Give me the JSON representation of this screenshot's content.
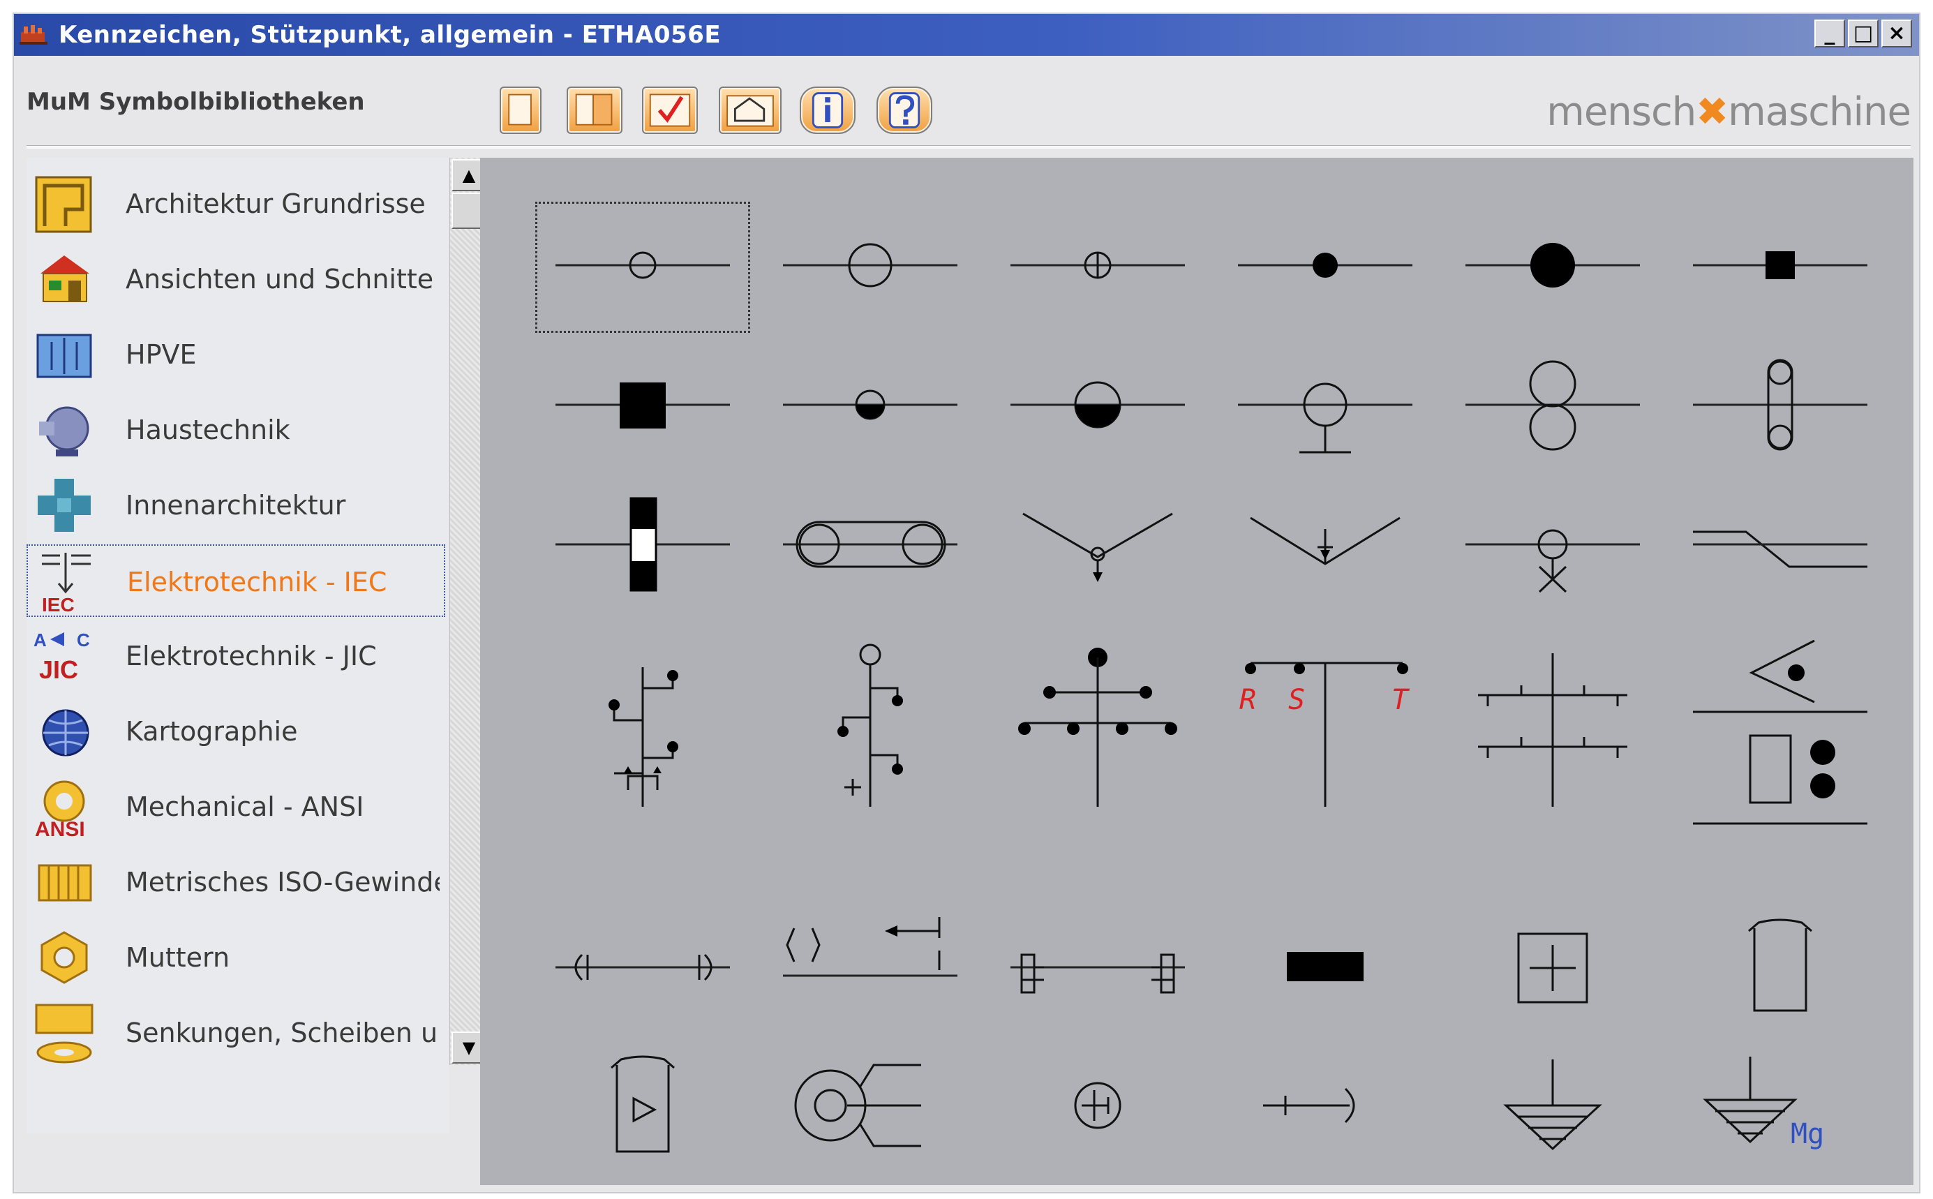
{
  "window": {
    "title": "Kennzeichen, Stützpunkt, allgemein  -  ETHA056E",
    "controls": [
      "_",
      "□",
      "×"
    ]
  },
  "toolbar": {
    "label": "MuM Symbolbibliotheken",
    "buttons": [
      "new-sheet-icon",
      "page-icon",
      "checkmark-icon",
      "house-icon",
      "info-icon",
      "help-icon"
    ],
    "brand": {
      "left": "mensch",
      "mark": "✖",
      "right": "maschine"
    }
  },
  "sidebar": {
    "items": [
      {
        "label": "Architektur Grundrisse",
        "icon": "floorplan-icon"
      },
      {
        "label": "Ansichten und Schnitte",
        "icon": "house-icon"
      },
      {
        "label": "HPVE",
        "icon": "hpve-icon"
      },
      {
        "label": "Haustechnik",
        "icon": "hvac-icon"
      },
      {
        "label": "Innenarchitektur",
        "icon": "furniture-icon"
      },
      {
        "label": "Elektrotechnik - IEC",
        "icon": "iec-icon",
        "badge": "IEC",
        "selected": true
      },
      {
        "label": "Elektrotechnik - JIC",
        "icon": "jic-icon",
        "badge": "JIC"
      },
      {
        "label": "Kartographie",
        "icon": "globe-icon"
      },
      {
        "label": "Mechanical - ANSI",
        "icon": "gear-icon",
        "badge": "ANSI"
      },
      {
        "label": "Metrisches ISO-Gewinde",
        "icon": "thread-icon"
      },
      {
        "label": "Muttern",
        "icon": "nut-icon"
      },
      {
        "label": "Senkungen, Scheiben und Du",
        "icon": "washer-icon"
      }
    ]
  },
  "symbols": {
    "labels": {
      "r": "R",
      "s": "S",
      "t": "T",
      "mg": "Mg"
    }
  },
  "colors": {
    "accent": "#f07818",
    "title_bar": "#2a4aa8",
    "grid_bg": "#b0b1b7",
    "red_label": "#e02020",
    "blue_label": "#3050c0"
  }
}
